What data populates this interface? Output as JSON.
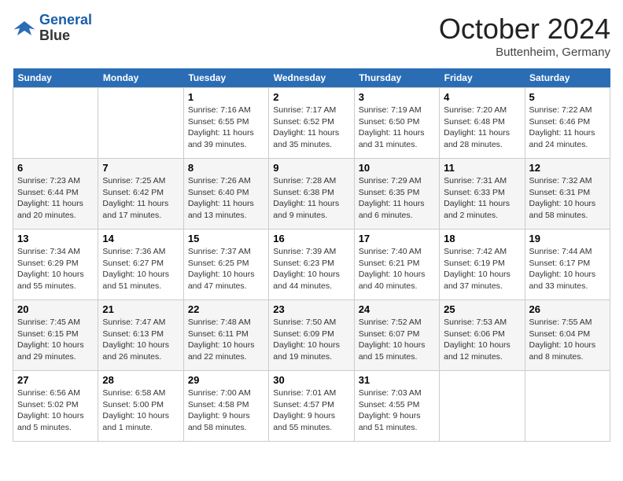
{
  "header": {
    "logo_line1": "General",
    "logo_line2": "Blue",
    "month": "October 2024",
    "location": "Buttenheim, Germany"
  },
  "weekdays": [
    "Sunday",
    "Monday",
    "Tuesday",
    "Wednesday",
    "Thursday",
    "Friday",
    "Saturday"
  ],
  "weeks": [
    [
      {
        "day": "",
        "sunrise": "",
        "sunset": "",
        "daylight": ""
      },
      {
        "day": "",
        "sunrise": "",
        "sunset": "",
        "daylight": ""
      },
      {
        "day": "1",
        "sunrise": "Sunrise: 7:16 AM",
        "sunset": "Sunset: 6:55 PM",
        "daylight": "Daylight: 11 hours and 39 minutes."
      },
      {
        "day": "2",
        "sunrise": "Sunrise: 7:17 AM",
        "sunset": "Sunset: 6:52 PM",
        "daylight": "Daylight: 11 hours and 35 minutes."
      },
      {
        "day": "3",
        "sunrise": "Sunrise: 7:19 AM",
        "sunset": "Sunset: 6:50 PM",
        "daylight": "Daylight: 11 hours and 31 minutes."
      },
      {
        "day": "4",
        "sunrise": "Sunrise: 7:20 AM",
        "sunset": "Sunset: 6:48 PM",
        "daylight": "Daylight: 11 hours and 28 minutes."
      },
      {
        "day": "5",
        "sunrise": "Sunrise: 7:22 AM",
        "sunset": "Sunset: 6:46 PM",
        "daylight": "Daylight: 11 hours and 24 minutes."
      }
    ],
    [
      {
        "day": "6",
        "sunrise": "Sunrise: 7:23 AM",
        "sunset": "Sunset: 6:44 PM",
        "daylight": "Daylight: 11 hours and 20 minutes."
      },
      {
        "day": "7",
        "sunrise": "Sunrise: 7:25 AM",
        "sunset": "Sunset: 6:42 PM",
        "daylight": "Daylight: 11 hours and 17 minutes."
      },
      {
        "day": "8",
        "sunrise": "Sunrise: 7:26 AM",
        "sunset": "Sunset: 6:40 PM",
        "daylight": "Daylight: 11 hours and 13 minutes."
      },
      {
        "day": "9",
        "sunrise": "Sunrise: 7:28 AM",
        "sunset": "Sunset: 6:38 PM",
        "daylight": "Daylight: 11 hours and 9 minutes."
      },
      {
        "day": "10",
        "sunrise": "Sunrise: 7:29 AM",
        "sunset": "Sunset: 6:35 PM",
        "daylight": "Daylight: 11 hours and 6 minutes."
      },
      {
        "day": "11",
        "sunrise": "Sunrise: 7:31 AM",
        "sunset": "Sunset: 6:33 PM",
        "daylight": "Daylight: 11 hours and 2 minutes."
      },
      {
        "day": "12",
        "sunrise": "Sunrise: 7:32 AM",
        "sunset": "Sunset: 6:31 PM",
        "daylight": "Daylight: 10 hours and 58 minutes."
      }
    ],
    [
      {
        "day": "13",
        "sunrise": "Sunrise: 7:34 AM",
        "sunset": "Sunset: 6:29 PM",
        "daylight": "Daylight: 10 hours and 55 minutes."
      },
      {
        "day": "14",
        "sunrise": "Sunrise: 7:36 AM",
        "sunset": "Sunset: 6:27 PM",
        "daylight": "Daylight: 10 hours and 51 minutes."
      },
      {
        "day": "15",
        "sunrise": "Sunrise: 7:37 AM",
        "sunset": "Sunset: 6:25 PM",
        "daylight": "Daylight: 10 hours and 47 minutes."
      },
      {
        "day": "16",
        "sunrise": "Sunrise: 7:39 AM",
        "sunset": "Sunset: 6:23 PM",
        "daylight": "Daylight: 10 hours and 44 minutes."
      },
      {
        "day": "17",
        "sunrise": "Sunrise: 7:40 AM",
        "sunset": "Sunset: 6:21 PM",
        "daylight": "Daylight: 10 hours and 40 minutes."
      },
      {
        "day": "18",
        "sunrise": "Sunrise: 7:42 AM",
        "sunset": "Sunset: 6:19 PM",
        "daylight": "Daylight: 10 hours and 37 minutes."
      },
      {
        "day": "19",
        "sunrise": "Sunrise: 7:44 AM",
        "sunset": "Sunset: 6:17 PM",
        "daylight": "Daylight: 10 hours and 33 minutes."
      }
    ],
    [
      {
        "day": "20",
        "sunrise": "Sunrise: 7:45 AM",
        "sunset": "Sunset: 6:15 PM",
        "daylight": "Daylight: 10 hours and 29 minutes."
      },
      {
        "day": "21",
        "sunrise": "Sunrise: 7:47 AM",
        "sunset": "Sunset: 6:13 PM",
        "daylight": "Daylight: 10 hours and 26 minutes."
      },
      {
        "day": "22",
        "sunrise": "Sunrise: 7:48 AM",
        "sunset": "Sunset: 6:11 PM",
        "daylight": "Daylight: 10 hours and 22 minutes."
      },
      {
        "day": "23",
        "sunrise": "Sunrise: 7:50 AM",
        "sunset": "Sunset: 6:09 PM",
        "daylight": "Daylight: 10 hours and 19 minutes."
      },
      {
        "day": "24",
        "sunrise": "Sunrise: 7:52 AM",
        "sunset": "Sunset: 6:07 PM",
        "daylight": "Daylight: 10 hours and 15 minutes."
      },
      {
        "day": "25",
        "sunrise": "Sunrise: 7:53 AM",
        "sunset": "Sunset: 6:06 PM",
        "daylight": "Daylight: 10 hours and 12 minutes."
      },
      {
        "day": "26",
        "sunrise": "Sunrise: 7:55 AM",
        "sunset": "Sunset: 6:04 PM",
        "daylight": "Daylight: 10 hours and 8 minutes."
      }
    ],
    [
      {
        "day": "27",
        "sunrise": "Sunrise: 6:56 AM",
        "sunset": "Sunset: 5:02 PM",
        "daylight": "Daylight: 10 hours and 5 minutes."
      },
      {
        "day": "28",
        "sunrise": "Sunrise: 6:58 AM",
        "sunset": "Sunset: 5:00 PM",
        "daylight": "Daylight: 10 hours and 1 minute."
      },
      {
        "day": "29",
        "sunrise": "Sunrise: 7:00 AM",
        "sunset": "Sunset: 4:58 PM",
        "daylight": "Daylight: 9 hours and 58 minutes."
      },
      {
        "day": "30",
        "sunrise": "Sunrise: 7:01 AM",
        "sunset": "Sunset: 4:57 PM",
        "daylight": "Daylight: 9 hours and 55 minutes."
      },
      {
        "day": "31",
        "sunrise": "Sunrise: 7:03 AM",
        "sunset": "Sunset: 4:55 PM",
        "daylight": "Daylight: 9 hours and 51 minutes."
      },
      {
        "day": "",
        "sunrise": "",
        "sunset": "",
        "daylight": ""
      },
      {
        "day": "",
        "sunrise": "",
        "sunset": "",
        "daylight": ""
      }
    ]
  ]
}
